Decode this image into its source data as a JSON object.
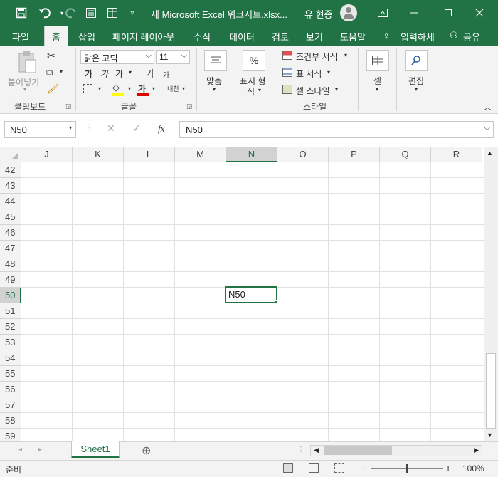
{
  "titlebar": {
    "title": "새 Microsoft Excel 워크시트.xlsx...",
    "user": "유 현종"
  },
  "tabs": [
    "파일",
    "홈",
    "삽입",
    "페이지 레이아웃",
    "수식",
    "데이터",
    "검토",
    "보기",
    "도움말",
    "입력하세",
    "공유"
  ],
  "ribbon": {
    "clipboard": {
      "paste": "붙여넣기",
      "label": "클립보드"
    },
    "font": {
      "name": "맑은 고딕",
      "size": "11",
      "label": "글꼴",
      "bold": "가",
      "italic": "가",
      "underline": "가",
      "grow": "가",
      "shrink": "가",
      "color": "가",
      "phonetic": "내천"
    },
    "align": {
      "label": "맞춤"
    },
    "number": {
      "label_1": "표시 형",
      "label_2": "식"
    },
    "styles": {
      "cond": "조건부 서식",
      "table": "표 서식",
      "cell": "셀 스타일",
      "label": "스타일"
    },
    "cells": {
      "label": "셀"
    },
    "edit": {
      "label": "편집"
    }
  },
  "formula_bar": {
    "name_box": "N50",
    "fx": "fx",
    "formula": "N50"
  },
  "grid": {
    "columns": [
      "J",
      "K",
      "L",
      "M",
      "N",
      "O",
      "P",
      "Q",
      "R"
    ],
    "selected_column": "N",
    "rows": [
      "42",
      "43",
      "44",
      "45",
      "46",
      "47",
      "48",
      "49",
      "50",
      "51",
      "52",
      "53",
      "54",
      "55",
      "56",
      "57",
      "58",
      "59"
    ],
    "selected_row": "50",
    "selected_cell_value": "N50"
  },
  "sheets": [
    "Sheet1"
  ],
  "status": {
    "ready": "준비",
    "zoom": "100%"
  }
}
